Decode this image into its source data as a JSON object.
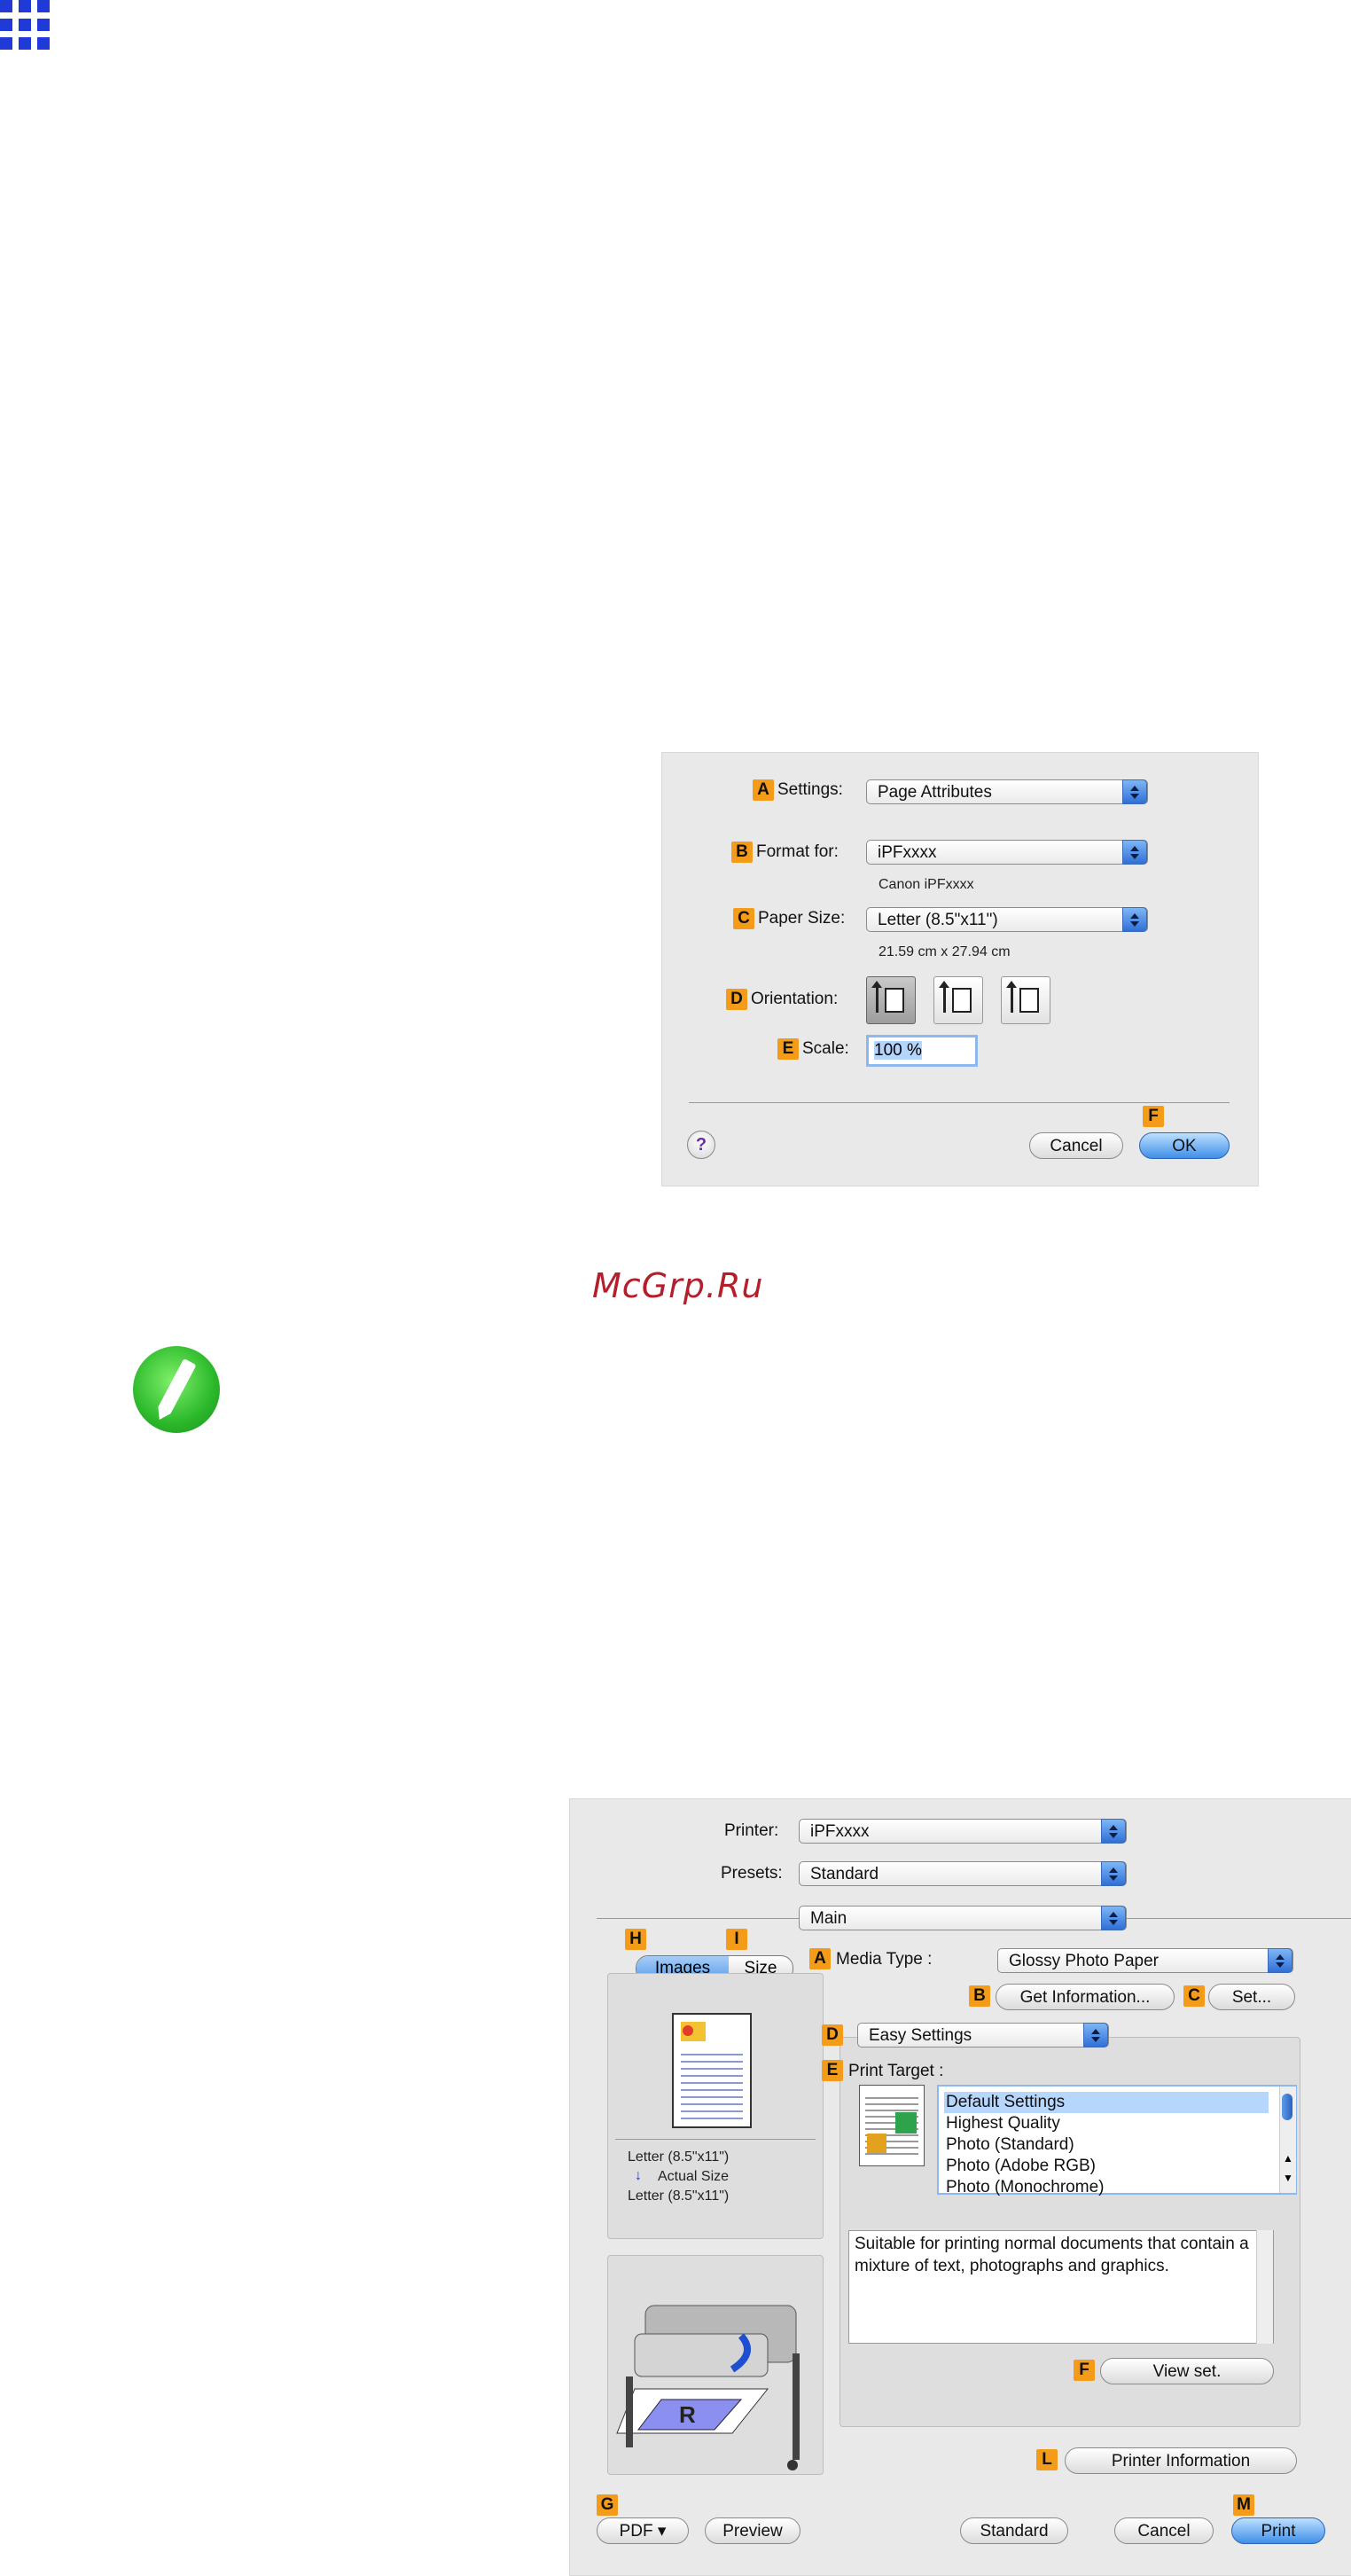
{
  "page_dialog": {
    "settings_label": "Settings:",
    "settings_value": "Page Attributes",
    "format_label": "Format for:",
    "format_value": "iPFxxxx",
    "format_sub": "Canon iPFxxxx",
    "paper_label": "Paper Size:",
    "paper_value": "Letter (8.5\"x11\")",
    "paper_sub": "21.59 cm x 27.94 cm",
    "orientation_label": "Orientation:",
    "scale_label": "Scale:",
    "scale_value": "100 %",
    "help": "?",
    "cancel": "Cancel",
    "ok": "OK",
    "keys": {
      "a": "A",
      "b": "B",
      "c": "C",
      "d": "D",
      "e": "E",
      "f": "F"
    }
  },
  "watermark": "McGrp.Ru",
  "print_dialog": {
    "printer_label": "Printer:",
    "printer_value": "iPFxxxx",
    "presets_label": "Presets:",
    "presets_value": "Standard",
    "panel_value": "Main",
    "tab_images": "Images",
    "tab_size": "Size",
    "media_type_label": "Media Type :",
    "media_type_value": "Glossy Photo Paper",
    "get_info": "Get Information...",
    "set": "Set...",
    "easy_settings": "Easy Settings",
    "print_target_label": "Print Target :",
    "targets": [
      "Default Settings",
      "Highest Quality",
      "Photo (Standard)",
      "Photo (Adobe RGB)",
      "Photo (Monochrome)"
    ],
    "description": "Suitable for printing normal documents that contain a mixture of text, photographs and graphics.",
    "view_set": "View set.",
    "printer_info": "Printer Information",
    "size_from": "Letter (8.5\"x11\")",
    "actual_size": "Actual Size",
    "size_to": "Letter (8.5\"x11\")",
    "pdf": "PDF ▾",
    "preview": "Preview",
    "standard": "Standard",
    "cancel": "Cancel",
    "print": "Print",
    "keys": {
      "a": "A",
      "b": "B",
      "c": "C",
      "d": "D",
      "e": "E",
      "f": "F",
      "g": "G",
      "h": "H",
      "i": "I",
      "l": "L",
      "m": "M"
    }
  },
  "colors": {
    "accent": "#f59b1a",
    "selection": "#b7d6fb",
    "watermark": "#b3202c",
    "grid_icon": "#1f3ad6"
  }
}
